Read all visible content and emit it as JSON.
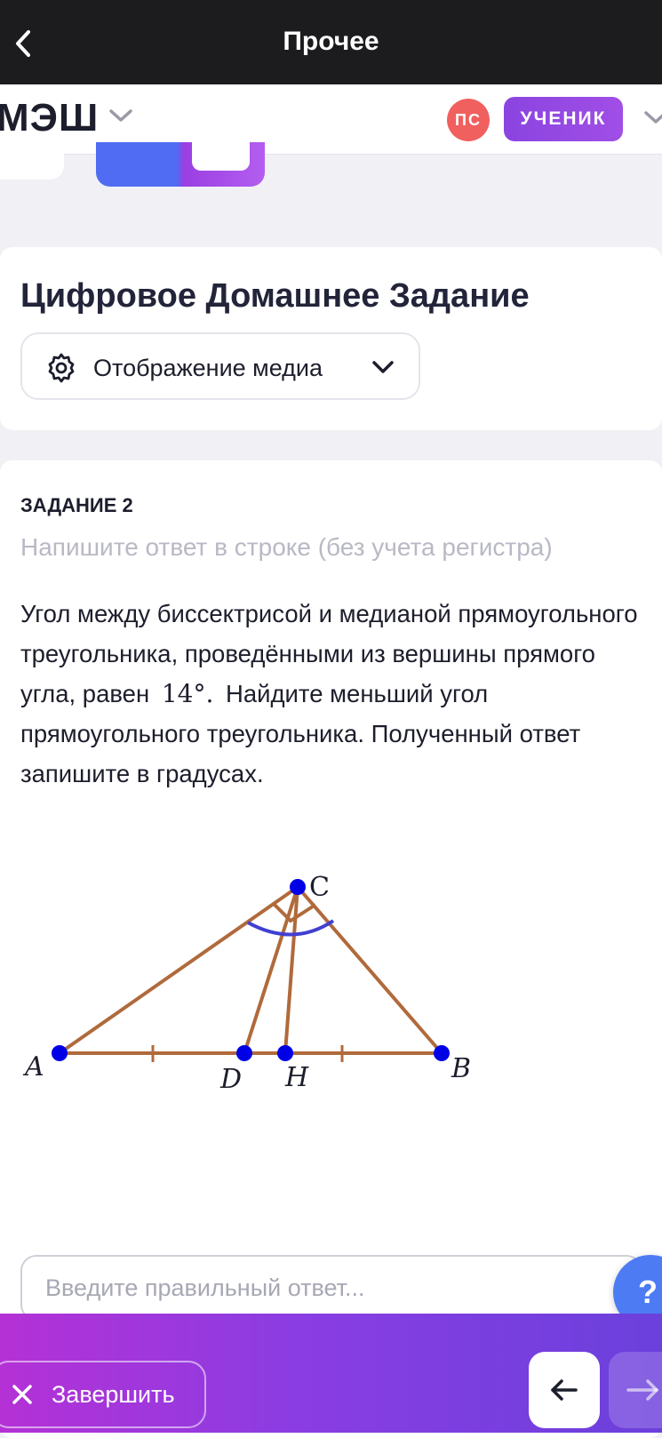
{
  "topbar": {
    "title": "Прочее"
  },
  "appbar": {
    "logo": "МЭШ",
    "avatar_initials": "ПС",
    "role": "УЧЕНИК"
  },
  "header": {
    "title": "Цифровое Домашнее Задание",
    "media_button": "Отображение медиа"
  },
  "task": {
    "number": "ЗАДАНИЕ 2",
    "hint": "Напишите ответ в строке (без учета регистра)",
    "text_before": "Угол между биссектрисой и медианой прямоугольного треугольника, проведёнными из вершины прямого угла, равен",
    "math_value": "14°.",
    "text_after": "Найдите меньший угол прямоугольного треугольника. Полученный ответ запишите в градусах.",
    "figure_labels": {
      "a": "A",
      "b": "B",
      "c": "C",
      "d": "D",
      "h": "H"
    }
  },
  "answer": {
    "placeholder": "Введите правильный ответ..."
  },
  "help": {
    "label": "?"
  },
  "bottom": {
    "finish_label": "Завершить"
  },
  "colors": {
    "accent": "#8b44e0",
    "help": "#4d7bf3",
    "triangle": "#b06a3b",
    "points": "#0000e6",
    "arc": "#4040d0"
  }
}
